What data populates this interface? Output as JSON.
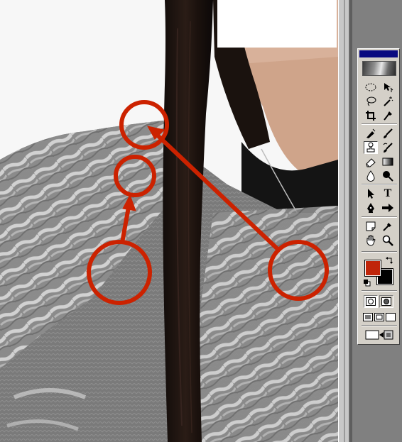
{
  "canvas": {
    "annotation_color": "#cc2200",
    "hair_color": "#1a1210",
    "fur_color": "#9a9a9a",
    "top_color": "#151515"
  },
  "toolbox": {
    "title_color": "#0a0a80",
    "tools": [
      {
        "name": "marquee-tool-icon"
      },
      {
        "name": "move-tool-icon"
      },
      {
        "name": "lasso-tool-icon"
      },
      {
        "name": "magic-wand-tool-icon"
      },
      {
        "name": "crop-tool-icon"
      },
      {
        "name": "eyedropper-slice-tool-icon"
      },
      {
        "name": "airbrush-tool-icon"
      },
      {
        "name": "paintbrush-tool-icon"
      },
      {
        "name": "rubber-stamp-tool-icon"
      },
      {
        "name": "history-brush-tool-icon"
      },
      {
        "name": "eraser-tool-icon"
      },
      {
        "name": "gradient-tool-icon"
      },
      {
        "name": "blur-tool-icon"
      },
      {
        "name": "dodge-tool-icon"
      },
      {
        "name": "path-select-tool-icon"
      },
      {
        "name": "type-tool-icon"
      },
      {
        "name": "pen-tool-icon"
      },
      {
        "name": "shape-tool-icon"
      },
      {
        "name": "notes-tool-icon"
      },
      {
        "name": "eyedropper-tool-icon"
      },
      {
        "name": "hand-tool-icon"
      },
      {
        "name": "zoom-tool-icon"
      }
    ],
    "type_tool_glyph": "T",
    "foreground_color": "#c0250a",
    "background_color": "#000000",
    "active_tool": "rubber-stamp-tool-icon"
  }
}
